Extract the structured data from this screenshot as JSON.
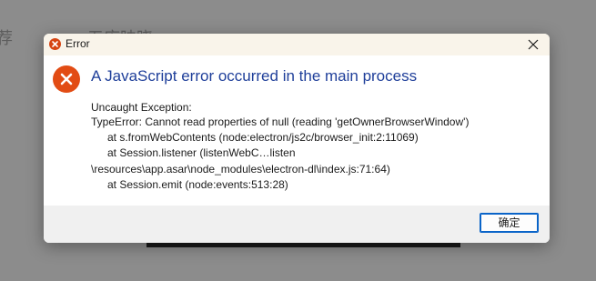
{
  "background": {
    "left_fragment": "荐",
    "mid_fragment": "五库映晓"
  },
  "dialog": {
    "title": "Error",
    "headline": "A JavaScript error occurred in the main process",
    "message_lines": [
      "Uncaught Exception:",
      "TypeError: Cannot read properties of null (reading 'getOwnerBrowserWindow')",
      "at s.fromWebContents (node:electron/js2c/browser_init:2:11069)",
      "at Session.listener (listenWebC…listen",
      "\\resources\\app.asar\\node_modules\\electron-dl\\index.js:71:64)",
      "at Session.emit (node:events:513:28)"
    ],
    "ok_label": "确定"
  },
  "colors": {
    "headline": "#1f3f9a",
    "error_icon": "#e24c14",
    "button_border": "#0a64c8",
    "overlay": "#8c8c8c"
  },
  "icons": {
    "title": "error-circle-icon",
    "close": "close-icon",
    "main": "error-circle-icon"
  }
}
